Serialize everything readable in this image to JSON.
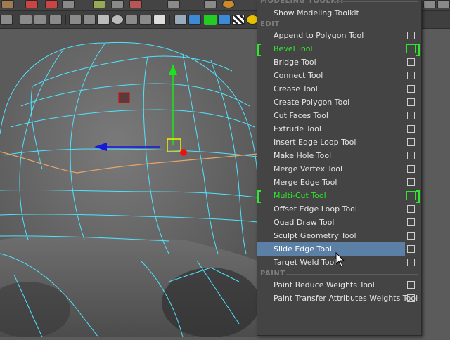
{
  "app": {
    "toolbar_row1_icons": [
      "select-tool-icon",
      "lasso-icon",
      "paint-select-icon",
      "move-icon",
      "rotate-icon",
      "scale-icon",
      "save-icon",
      "grid-snap-icon",
      "pivot-icon",
      "render-icon"
    ],
    "toolbar_row2_icons": [
      "polygon-cube-icon",
      "bevel-icon",
      "extrude-icon",
      "bridge-icon",
      "wireframe-icon",
      "smooth-shade-icon",
      "textured-icon",
      "xray-icon",
      "camera-icon",
      "texture-icon",
      "cube-icon",
      "cylinder-icon",
      "sphere-icon",
      "checker-icon"
    ]
  },
  "menu": {
    "sections": [
      {
        "header": "MODELING TOOLKIT",
        "items": [
          {
            "label": "Show Modeling Toolkit",
            "has_option_box": false
          }
        ]
      },
      {
        "header": "EDIT",
        "items": [
          {
            "label": "Append to Polygon Tool",
            "has_option_box": true
          },
          {
            "label": "Bevel Tool",
            "has_option_box": true,
            "highlighted": true
          },
          {
            "label": "Bridge Tool",
            "has_option_box": true
          },
          {
            "label": "Connect Tool",
            "has_option_box": true
          },
          {
            "label": "Crease Tool",
            "has_option_box": true
          },
          {
            "label": "Create Polygon Tool",
            "has_option_box": true
          },
          {
            "label": "Cut Faces Tool",
            "has_option_box": true
          },
          {
            "label": "Extrude Tool",
            "has_option_box": true
          },
          {
            "label": "Insert Edge Loop Tool",
            "has_option_box": true
          },
          {
            "label": "Make Hole Tool",
            "has_option_box": true
          },
          {
            "label": "Merge Vertex Tool",
            "has_option_box": true
          },
          {
            "label": "Merge Edge Tool",
            "has_option_box": true
          },
          {
            "label": "Multi-Cut Tool",
            "has_option_box": true,
            "highlighted": true
          },
          {
            "label": "Offset Edge Loop Tool",
            "has_option_box": true
          },
          {
            "label": "Quad Draw Tool",
            "has_option_box": true
          },
          {
            "label": "Sculpt Geometry Tool",
            "has_option_box": true
          },
          {
            "label": "Slide Edge Tool",
            "has_option_box": true,
            "active": true
          },
          {
            "label": "Target Weld Tool",
            "has_option_box": true
          }
        ]
      },
      {
        "header": "PAINT",
        "items": [
          {
            "label": "Paint Reduce Weights Tool",
            "has_option_box": true
          },
          {
            "label": "Paint Transfer Attributes Weights Tool",
            "has_option_box": true
          }
        ]
      }
    ]
  },
  "colors": {
    "highlight_green": "#2ee62e",
    "active_blue": "#5c7fa6",
    "wire_cyan": "#4fe3ff",
    "mesh_gray": "#6a6a6a",
    "axis_y_green": "#19e619",
    "axis_x_blue": "#1818d8"
  }
}
